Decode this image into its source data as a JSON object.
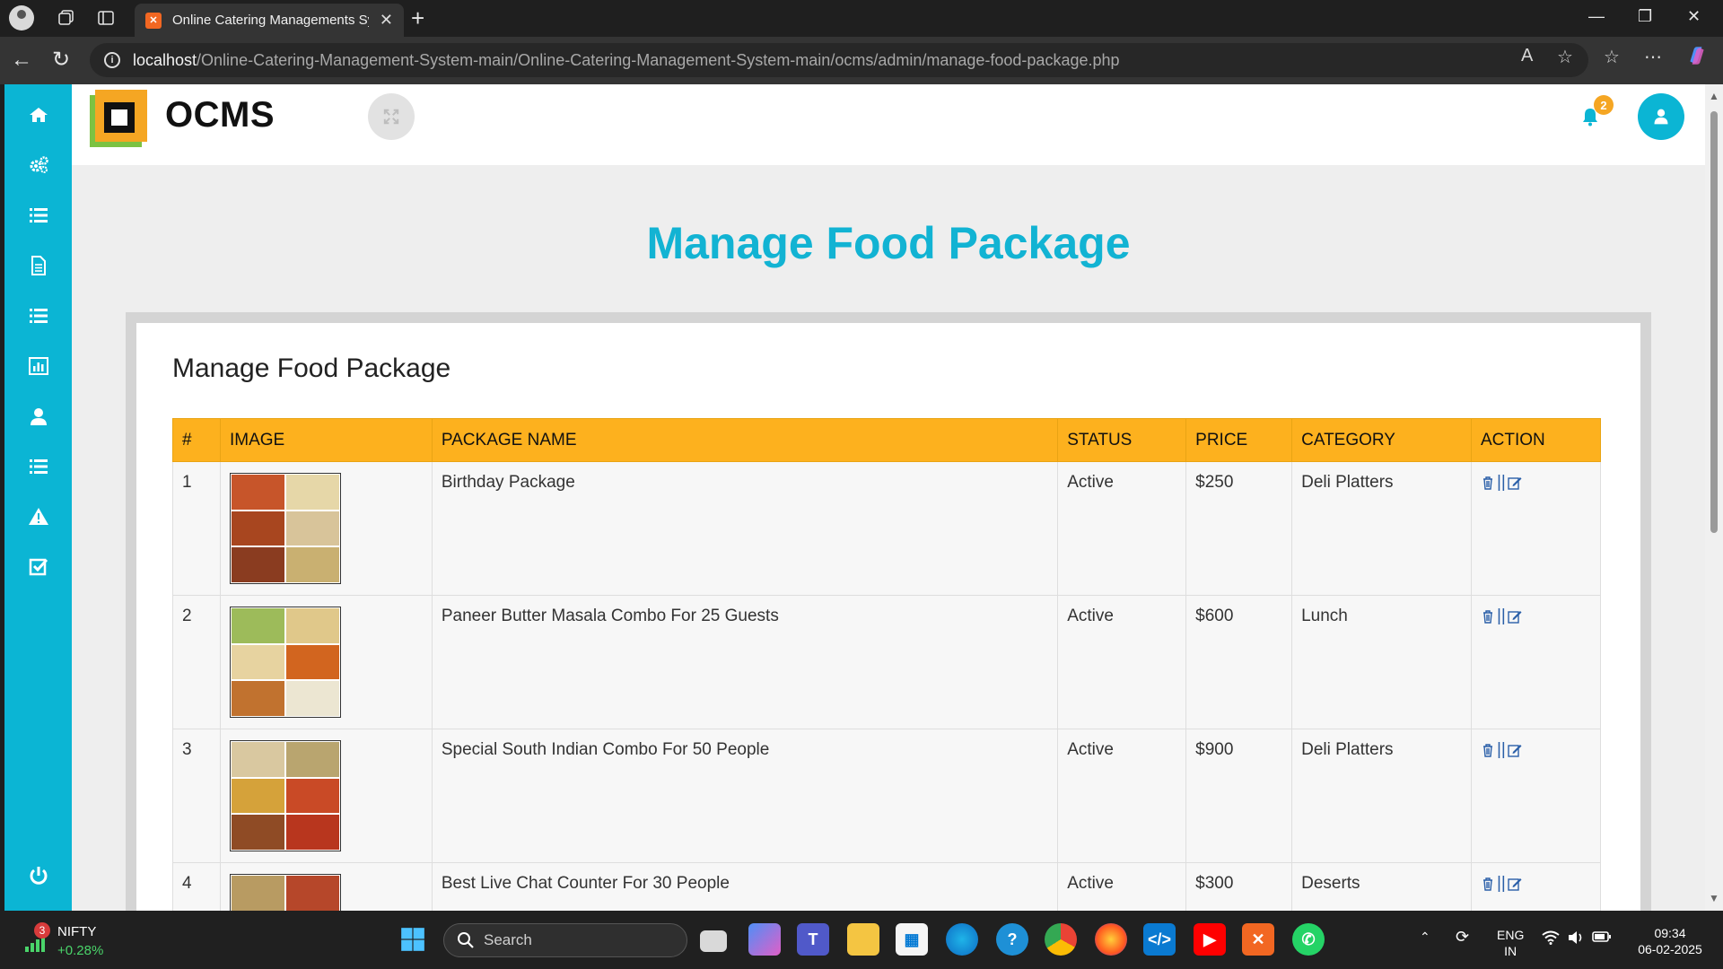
{
  "browser": {
    "tab_title": "Online Catering Managements Sy",
    "url_host": "localhost",
    "url_path": "/Online-Catering-Management-System-main/Online-Catering-Management-System-main/ocms/admin/manage-food-package.php"
  },
  "app": {
    "brand": "OCMS",
    "notification_count": "2",
    "page_heading": "Manage Food Package",
    "card_title": "Manage Food Package"
  },
  "sidebar": {
    "icons": [
      "home-icon",
      "gears-icon",
      "list-icon",
      "file-icon",
      "list-icon",
      "bar-chart-icon",
      "user-icon",
      "list-icon",
      "warning-icon",
      "check-square-icon",
      "power-icon"
    ]
  },
  "table": {
    "headers": [
      "#",
      "IMAGE",
      "PACKAGE NAME",
      "STATUS",
      "PRICE",
      "CATEGORY",
      "ACTION"
    ],
    "rows": [
      {
        "num": "1",
        "name": "Birthday Package",
        "status": "Active",
        "price": "$250",
        "category": "Deli Platters"
      },
      {
        "num": "2",
        "name": "Paneer Butter Masala Combo For 25 Guests",
        "status": "Active",
        "price": "$600",
        "category": "Lunch"
      },
      {
        "num": "3",
        "name": "Special South Indian Combo For 50 People",
        "status": "Active",
        "price": "$900",
        "category": "Deli Platters"
      },
      {
        "num": "4",
        "name": "Best Live Chat Counter For 30 People",
        "status": "Active",
        "price": "$300",
        "category": "Deserts"
      }
    ],
    "action_separator": "||"
  },
  "taskbar": {
    "nifty_badge": "3",
    "nifty_label": "NIFTY",
    "nifty_change": "+0.28%",
    "search_placeholder": "Search",
    "lang_top": "ENG",
    "lang_bottom": "IN",
    "time": "09:34",
    "date": "06-02-2025"
  },
  "colors": {
    "accent": "#0bb5d4",
    "table_header": "#fdb11e",
    "heading": "#12b3d3",
    "badge": "#f5a623"
  }
}
